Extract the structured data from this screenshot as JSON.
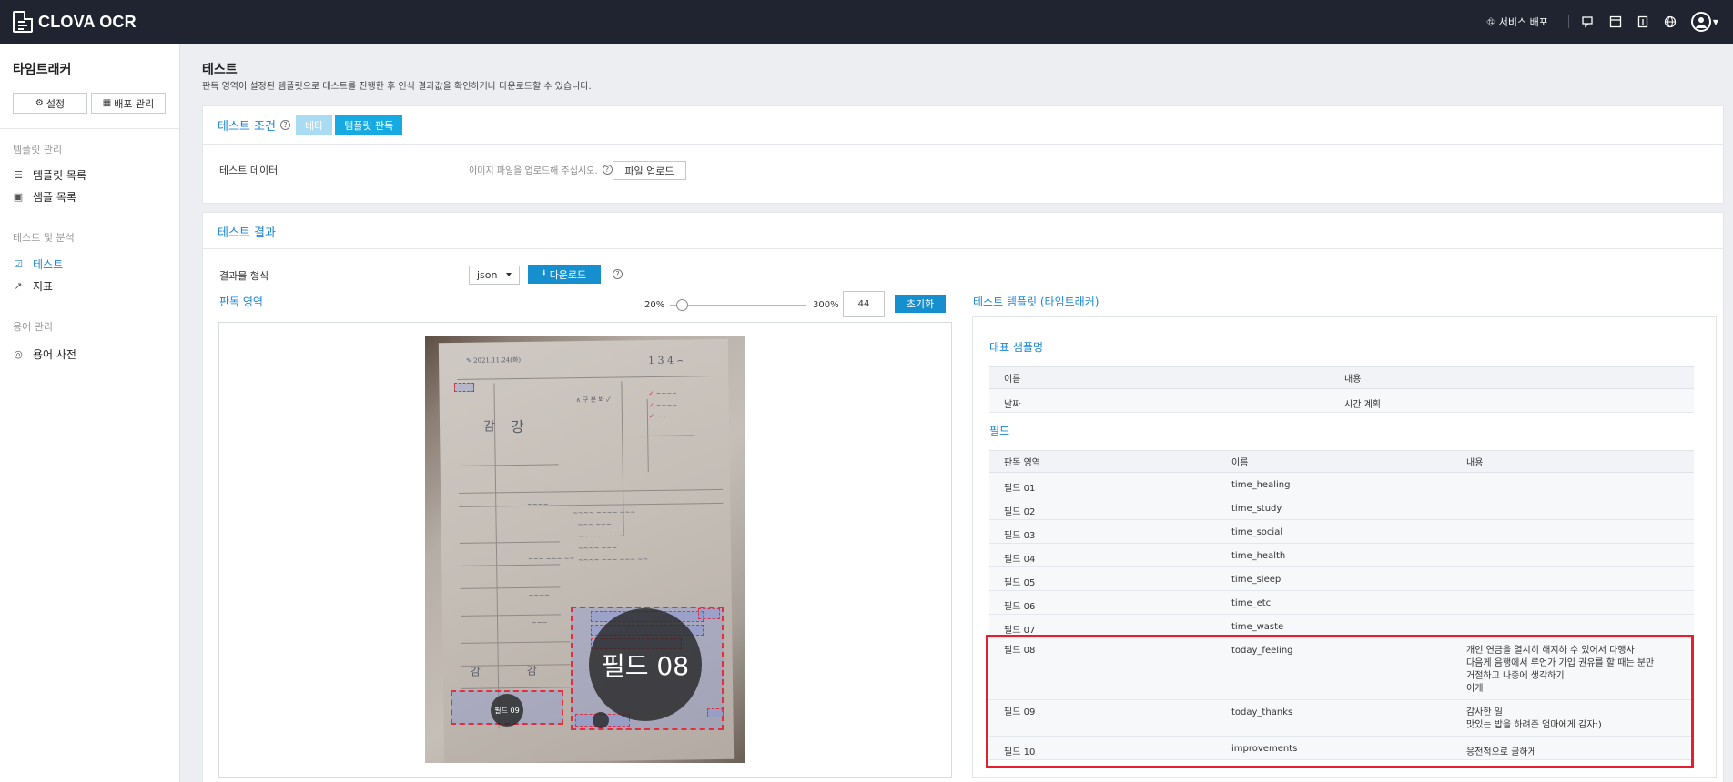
{
  "topbar": {
    "brand": "CLOVA OCR",
    "deploy_label": "서비스 배포"
  },
  "sidebar": {
    "title": "타임트래커",
    "settings_label": "설정",
    "deploy_manage_label": "배포 관리",
    "sections": [
      {
        "label": "템플릿 관리",
        "items": [
          "템플릿 목록",
          "샘플 목록"
        ]
      },
      {
        "label": "테스트 및 분석",
        "items": [
          "테스트",
          "지표"
        ]
      },
      {
        "label": "용어 관리",
        "items": [
          "용어 사전"
        ]
      }
    ]
  },
  "page": {
    "title": "테스트",
    "description": "판독 영역이 설정된 템플릿으로 테스트를 진행한 후 인식 결과값을 확인하거나 다운로드할 수 있습니다."
  },
  "conditions": {
    "title": "테스트 조건",
    "tab_beta": "베타",
    "tab_template": "템플릿 판독",
    "data_label": "테스트 데이터",
    "upload_hint": "이미지 파일을 업로드해 주십시오.",
    "upload_button": "파일 업로드"
  },
  "results": {
    "title": "테스트 결과",
    "format_label": "결과물 형식",
    "format_value": "json",
    "download_button": "다운로드",
    "region_title": "판독 영역",
    "zoom_min": "20%",
    "zoom_max": "300%",
    "zoom_value": "44",
    "zoom_fraction": 0.086,
    "reset_button": "초기화",
    "field08_label": "필드 08",
    "field09_label": "필드 09"
  },
  "template": {
    "title": "테스트 템플릿 (타임트래커)",
    "sample_title": "대표 샘플명",
    "sample_headers": [
      "이름",
      "내용"
    ],
    "sample_row": [
      "날짜",
      "시간 계획"
    ],
    "field_title": "필드",
    "field_headers": [
      "판독 영역",
      "이름",
      "내용"
    ],
    "fields": [
      {
        "area": "필드 01",
        "name": "time_healing",
        "content": ""
      },
      {
        "area": "필드 02",
        "name": "time_study",
        "content": ""
      },
      {
        "area": "필드 03",
        "name": "time_social",
        "content": ""
      },
      {
        "area": "필드 04",
        "name": "time_health",
        "content": ""
      },
      {
        "area": "필드 05",
        "name": "time_sleep",
        "content": ""
      },
      {
        "area": "필드 06",
        "name": "time_etc",
        "content": ""
      },
      {
        "area": "필드 07",
        "name": "time_waste",
        "content": ""
      },
      {
        "area": "필드 08",
        "name": "today_feeling",
        "content": "개인 연금을 열시히 해지하 수 있어서 다행사\n다음게 음행에서 루언가 가입 권유를 할 때는 분만\n거절하고 나중에 생각하기\n이게"
      },
      {
        "area": "필드 09",
        "name": "today_thanks",
        "content": "감사한 일\n맛있는 밥을 하려준 엄마에게 감자:)"
      },
      {
        "area": "필드 10",
        "name": "improvements",
        "content": "응전적으로 글하게"
      }
    ]
  },
  "colors": {
    "accent": "#1b87d5",
    "topbar": "#1f2430",
    "highlight": "#e4202e"
  }
}
